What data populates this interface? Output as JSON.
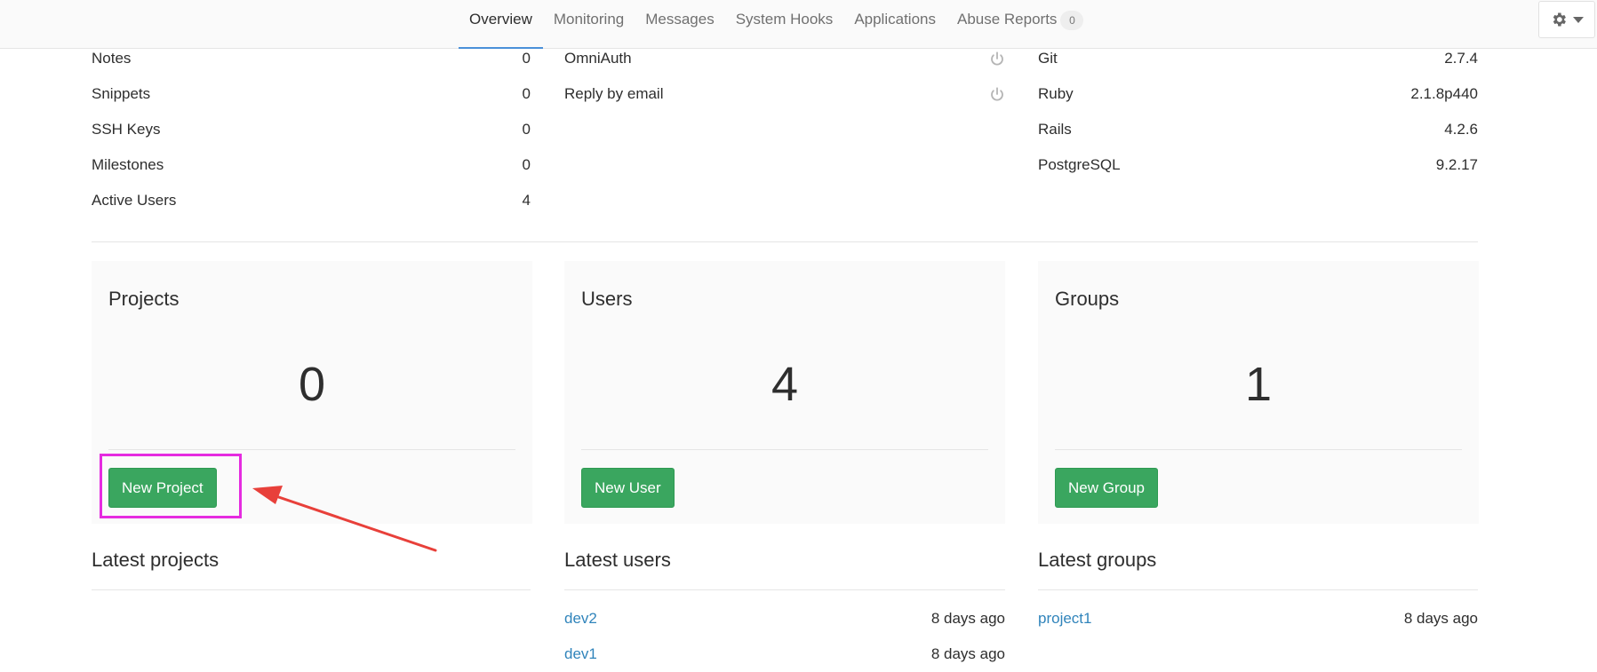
{
  "nav": {
    "tabs": [
      {
        "label": "Overview"
      },
      {
        "label": "Monitoring"
      },
      {
        "label": "Messages"
      },
      {
        "label": "System Hooks"
      },
      {
        "label": "Applications"
      },
      {
        "label": "Abuse Reports",
        "badge": "0"
      }
    ],
    "settings_icon": "gear-icon",
    "colors": {
      "active_underline": "#4a90d9"
    }
  },
  "stats": [
    {
      "label": "Notes",
      "value": "0"
    },
    {
      "label": "Snippets",
      "value": "0"
    },
    {
      "label": "SSH Keys",
      "value": "0"
    },
    {
      "label": "Milestones",
      "value": "0"
    },
    {
      "label": "Active Users",
      "value": "4"
    }
  ],
  "features": [
    {
      "label": "OmniAuth",
      "icon": "power-icon"
    },
    {
      "label": "Reply by email",
      "icon": "power-icon"
    }
  ],
  "components": [
    {
      "label": "Git",
      "value": "2.7.4"
    },
    {
      "label": "Ruby",
      "value": "2.1.8p440"
    },
    {
      "label": "Rails",
      "value": "4.2.6"
    },
    {
      "label": "PostgreSQL",
      "value": "9.2.17"
    }
  ],
  "cards": {
    "projects": {
      "title": "Projects",
      "count": "0",
      "button": "New Project"
    },
    "users": {
      "title": "Users",
      "count": "4",
      "button": "New User"
    },
    "groups": {
      "title": "Groups",
      "count": "1",
      "button": "New Group"
    }
  },
  "latest": {
    "projects": {
      "title": "Latest projects",
      "items": []
    },
    "users": {
      "title": "Latest users",
      "items": [
        {
          "name": "dev2",
          "time": "8 days ago"
        },
        {
          "name": "dev1",
          "time": "8 days ago"
        }
      ]
    },
    "groups": {
      "title": "Latest groups",
      "items": [
        {
          "name": "project1",
          "time": "8 days ago"
        }
      ]
    }
  },
  "colors": {
    "button_green": "#3aa65f",
    "link_blue": "#3084bb",
    "annotation_box": "#e52be0",
    "annotation_arrow": "#e8403a"
  }
}
